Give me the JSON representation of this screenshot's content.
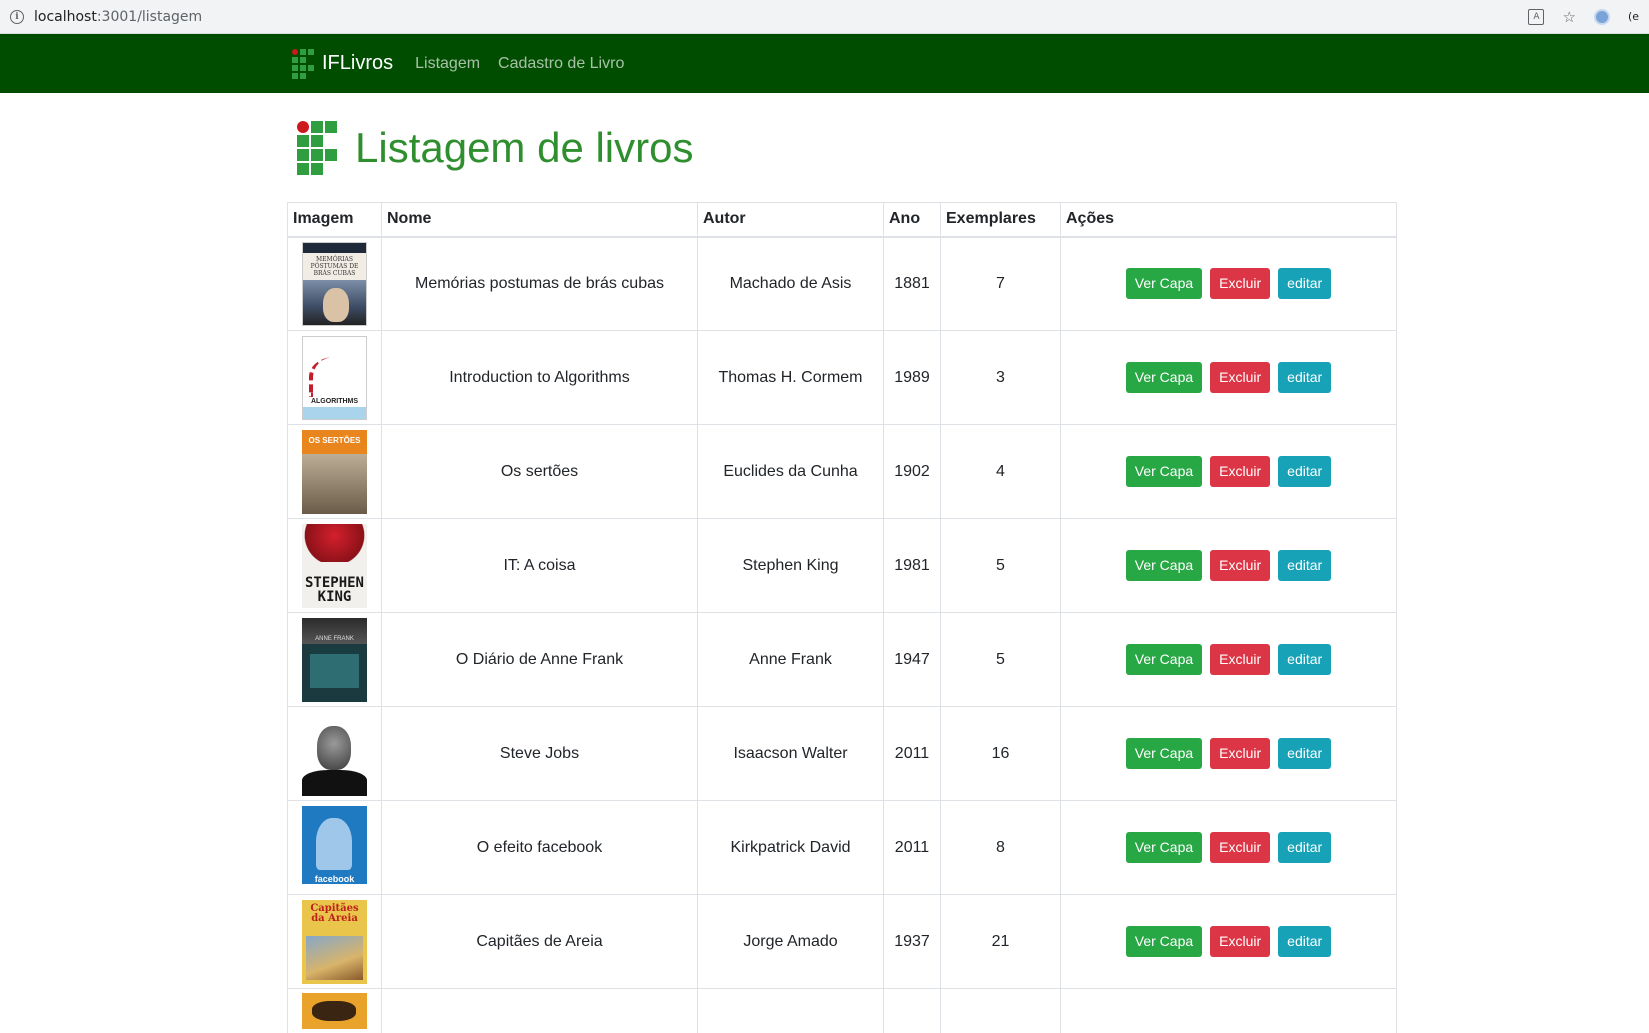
{
  "browser": {
    "url_host": "localhost",
    "url_path": ":3001/listagem"
  },
  "navbar": {
    "brand": "IFLivros",
    "links": [
      "Listagem",
      "Cadastro de Livro"
    ]
  },
  "page": {
    "title": "Listagem de livros"
  },
  "table": {
    "headers": [
      "Imagem",
      "Nome",
      "Autor",
      "Ano",
      "Exemplares",
      "Ações"
    ],
    "actions": {
      "ver_capa": "Ver Capa",
      "excluir": "Excluir",
      "editar": "editar"
    },
    "rows": [
      {
        "nome": "Memórias postumas de brás cubas",
        "autor": "Machado de Asis",
        "ano": "1881",
        "exemplares": "7",
        "cover_text": "MEMÓRIAS PÓSTUMAS DE BRÁS CUBAS"
      },
      {
        "nome": "Introduction to Algorithms",
        "autor": "Thomas H. Cormem",
        "ano": "1989",
        "exemplares": "3",
        "cover_text": "ALGORITHMS"
      },
      {
        "nome": "Os sertões",
        "autor": "Euclides da Cunha",
        "ano": "1902",
        "exemplares": "4",
        "cover_text": "OS SERTÕES"
      },
      {
        "nome": "IT: A coisa",
        "autor": "Stephen King",
        "ano": "1981",
        "exemplares": "5",
        "cover_text": "STEPHEN KING"
      },
      {
        "nome": "O Diário de Anne Frank",
        "autor": "Anne Frank",
        "ano": "1947",
        "exemplares": "5",
        "cover_text": "ANNE FRANK"
      },
      {
        "nome": "Steve Jobs",
        "autor": "Isaacson Walter",
        "ano": "2011",
        "exemplares": "16",
        "cover_text": ""
      },
      {
        "nome": "O efeito facebook",
        "autor": "Kirkpatrick David",
        "ano": "2011",
        "exemplares": "8",
        "cover_text": "facebook"
      },
      {
        "nome": "Capitães de Areia",
        "autor": "Jorge Amado",
        "ano": "1937",
        "exemplares": "21",
        "cover_text": "Capitães da Areia"
      }
    ]
  },
  "colors": {
    "navbar_bg": "#004d00",
    "title_green": "#2f8f2f",
    "btn_success": "#28a745",
    "btn_danger": "#dc3545",
    "btn_info": "#17a2b8"
  }
}
